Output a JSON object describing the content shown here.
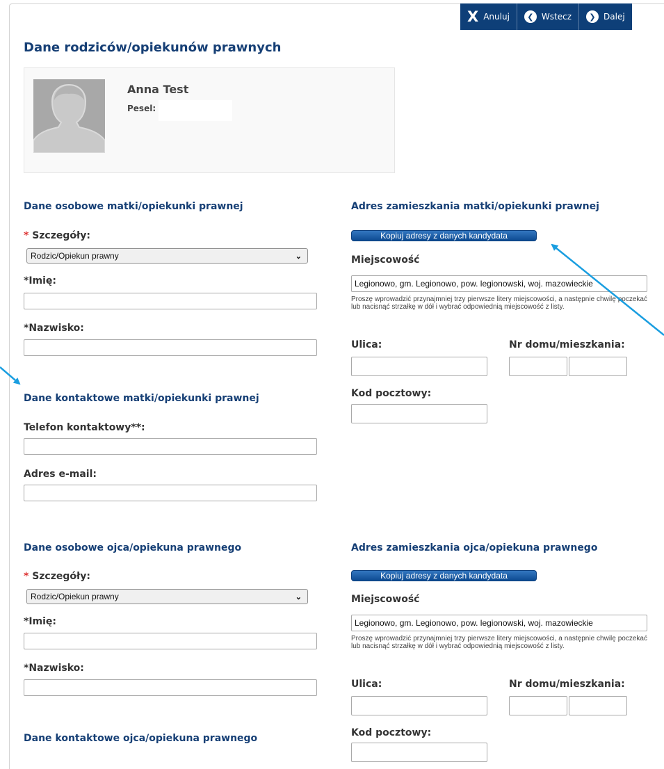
{
  "toolbar": {
    "cancel": "Anuluj",
    "back": "Wstecz",
    "next": "Dalej"
  },
  "page_title": "Dane rodziców/opiekunów prawnych",
  "candidate": {
    "name": "Anna Test",
    "pesel_label": "Pesel:"
  },
  "mother": {
    "personal_title": "Dane osobowe matki/opiekunki prawnej",
    "details_star": "*",
    "details_label": "Szczegóły:",
    "details_value": "Rodzic/Opiekun prawny",
    "first_name_label": "*Imię:",
    "last_name_label": "*Nazwisko:",
    "contact_title": "Dane kontaktowe matki/opiekunki prawnej",
    "phone_label": "Telefon kontaktowy**:",
    "email_label": "Adres e-mail:",
    "address_title": "Adres zamieszkania matki/opiekunki prawnej",
    "copy_button": "Kopiuj adresy z danych kandydata",
    "city_label": "Miejscowość",
    "city_value": "Legionowo, gm. Legionowo, pow. legionowski, woj. mazowieckie",
    "city_help": "Proszę wprowadzić przynajmniej trzy pierwsze litery miejscowości, a następnie chwilę poczekać lub nacisnąć strzałkę w dół i wybrać odpowiednią miejscowość z listy.",
    "street_label": "Ulica:",
    "house_label": "Nr domu/mieszkania:",
    "postal_label": "Kod pocztowy:"
  },
  "father": {
    "personal_title": "Dane osobowe ojca/opiekuna prawnego",
    "details_star": "*",
    "details_label": "Szczegóły:",
    "details_value": "Rodzic/Opiekun prawny",
    "first_name_label": "*Imię:",
    "last_name_label": "*Nazwisko:",
    "contact_title": "Dane kontaktowe ojca/opiekuna prawnego",
    "address_title": "Adres zamieszkania ojca/opiekuna prawnego",
    "copy_button": "Kopiuj adresy z danych kandydata",
    "city_label": "Miejscowość",
    "city_value": "Legionowo, gm. Legionowo, pow. legionowski, woj. mazowieckie",
    "city_help": "Proszę wprowadzić przynajmniej trzy pierwsze litery miejscowości, a następnie chwilę poczekać lub nacisnąć strzałkę w dół i wybrać odpowiednią miejscowość z listy.",
    "street_label": "Ulica:",
    "house_label": "Nr domu/mieszkania:",
    "postal_label": "Kod pocztowy:"
  },
  "colors": {
    "toolbar": "#0e3f78",
    "heading": "#163f75",
    "arrow": "#1a9ee0",
    "required": "#d33333"
  },
  "icons": {
    "cancel": "close-icon",
    "back": "circle-arrow-left-icon",
    "next": "circle-arrow-right-icon",
    "avatar": "user-silhouette-icon"
  }
}
